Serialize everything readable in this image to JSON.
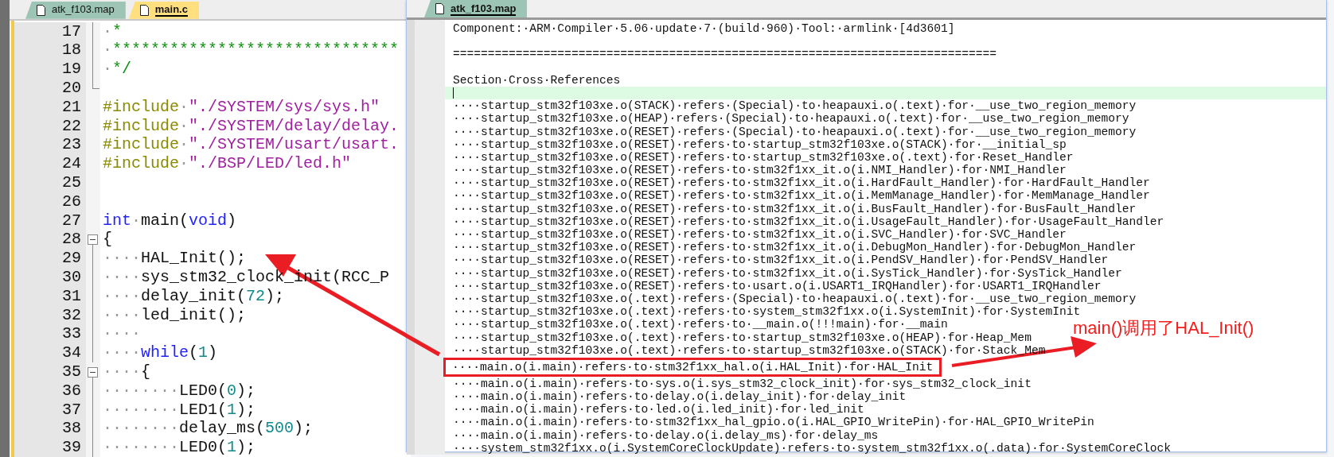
{
  "left_editor": {
    "tabs": [
      {
        "label": "atk_f103.map",
        "selected": false
      },
      {
        "label": "main.c",
        "selected": true
      }
    ],
    "lines": [
      {
        "number": "17",
        "kind": "fold_line",
        "tokens": [
          {
            "kind": "ws",
            "text": "·"
          },
          {
            "kind": "comment",
            "text": "*"
          }
        ]
      },
      {
        "number": "18",
        "kind": "fold_line",
        "tokens": [
          {
            "kind": "ws",
            "text": "·"
          },
          {
            "kind": "comment",
            "text": "******************************"
          }
        ]
      },
      {
        "number": "19",
        "kind": "fold_line",
        "tokens": [
          {
            "kind": "ws",
            "text": "·"
          },
          {
            "kind": "comment",
            "text": "*/"
          }
        ]
      },
      {
        "number": "20",
        "kind": "fold_end"
      },
      {
        "number": "21",
        "kind": "code",
        "tokens": [
          {
            "kind": "preproc",
            "text": "#include"
          },
          {
            "kind": "ws",
            "text": "·"
          },
          {
            "kind": "string",
            "text": "\"./SYSTEM/sys/sys.h\""
          }
        ]
      },
      {
        "number": "22",
        "kind": "code",
        "tokens": [
          {
            "kind": "preproc",
            "text": "#include"
          },
          {
            "kind": "ws",
            "text": "·"
          },
          {
            "kind": "string",
            "text": "\"./SYSTEM/delay/delay."
          }
        ]
      },
      {
        "number": "23",
        "kind": "code",
        "tokens": [
          {
            "kind": "preproc",
            "text": "#include"
          },
          {
            "kind": "ws",
            "text": "·"
          },
          {
            "kind": "string",
            "text": "\"./SYSTEM/usart/usart."
          }
        ]
      },
      {
        "number": "24",
        "kind": "code",
        "tokens": [
          {
            "kind": "preproc",
            "text": "#include"
          },
          {
            "kind": "ws",
            "text": "·"
          },
          {
            "kind": "string",
            "text": "\"./BSP/LED/led.h\""
          }
        ]
      },
      {
        "number": "25",
        "kind": "code"
      },
      {
        "number": "26",
        "kind": "code"
      },
      {
        "number": "27",
        "kind": "code",
        "tokens": [
          {
            "kind": "keyword",
            "text": "int"
          },
          {
            "kind": "ws",
            "text": "·"
          },
          {
            "kind": "plain",
            "text": "main("
          },
          {
            "kind": "keyword",
            "text": "void"
          },
          {
            "kind": "plain",
            "text": ")"
          }
        ]
      },
      {
        "number": "28",
        "kind": "fold_start",
        "tokens": [
          {
            "kind": "plain",
            "text": "{"
          }
        ]
      },
      {
        "number": "29",
        "kind": "fold_line",
        "tokens": [
          {
            "kind": "ws",
            "text": "····"
          },
          {
            "kind": "plain",
            "text": "HAL_Init();"
          }
        ]
      },
      {
        "number": "30",
        "kind": "fold_line",
        "tokens": [
          {
            "kind": "ws",
            "text": "····"
          },
          {
            "kind": "plain",
            "text": "sys_stm32_clock_init(RCC_P"
          }
        ]
      },
      {
        "number": "31",
        "kind": "fold_line",
        "tokens": [
          {
            "kind": "ws",
            "text": "····"
          },
          {
            "kind": "plain",
            "text": "delay_init("
          },
          {
            "kind": "number",
            "text": "72"
          },
          {
            "kind": "plain",
            "text": ");"
          }
        ]
      },
      {
        "number": "32",
        "kind": "fold_line",
        "tokens": [
          {
            "kind": "ws",
            "text": "····"
          },
          {
            "kind": "plain",
            "text": "led_init();"
          }
        ]
      },
      {
        "number": "33",
        "kind": "fold_line",
        "tokens": [
          {
            "kind": "ws",
            "text": "····"
          }
        ]
      },
      {
        "number": "34",
        "kind": "fold_line",
        "tokens": [
          {
            "kind": "ws",
            "text": "····"
          },
          {
            "kind": "keyword",
            "text": "while"
          },
          {
            "kind": "plain",
            "text": "("
          },
          {
            "kind": "number",
            "text": "1"
          },
          {
            "kind": "plain",
            "text": ")"
          }
        ]
      },
      {
        "number": "35",
        "kind": "fold_start",
        "tokens": [
          {
            "kind": "ws",
            "text": "····"
          },
          {
            "kind": "plain",
            "text": "{"
          }
        ]
      },
      {
        "number": "36",
        "kind": "fold_line",
        "tokens": [
          {
            "kind": "ws",
            "text": "········"
          },
          {
            "kind": "plain",
            "text": "LED0("
          },
          {
            "kind": "number",
            "text": "0"
          },
          {
            "kind": "plain",
            "text": ");"
          }
        ]
      },
      {
        "number": "37",
        "kind": "fold_line",
        "tokens": [
          {
            "kind": "ws",
            "text": "········"
          },
          {
            "kind": "plain",
            "text": "LED1("
          },
          {
            "kind": "number",
            "text": "1"
          },
          {
            "kind": "plain",
            "text": ");"
          }
        ]
      },
      {
        "number": "38",
        "kind": "fold_line",
        "tokens": [
          {
            "kind": "ws",
            "text": "········"
          },
          {
            "kind": "plain",
            "text": "delay_ms("
          },
          {
            "kind": "number",
            "text": "500"
          },
          {
            "kind": "plain",
            "text": ");"
          }
        ]
      },
      {
        "number": "39",
        "kind": "fold_line",
        "tokens": [
          {
            "kind": "ws",
            "text": "········"
          },
          {
            "kind": "plain",
            "text": "LED0("
          },
          {
            "kind": "number",
            "text": "1"
          },
          {
            "kind": "plain",
            "text": ");"
          }
        ]
      }
    ]
  },
  "map_window": {
    "tabs": [
      {
        "label": "atk_f103.map",
        "selected": true
      }
    ],
    "lines": [
      {
        "kind": "text",
        "text": "Component:·ARM·Compiler·5.06·update·7·(build·960)·Tool:·armlink·[4d3601]"
      },
      {
        "kind": "blank"
      },
      {
        "kind": "text",
        "text": "=============================================================================="
      },
      {
        "kind": "blank"
      },
      {
        "kind": "text",
        "text": "Section·Cross·References"
      },
      {
        "kind": "cursor"
      },
      {
        "kind": "text",
        "text": "····startup_stm32f103xe.o(STACK)·refers·(Special)·to·heapauxi.o(.text)·for·__use_two_region_memory"
      },
      {
        "kind": "text",
        "text": "····startup_stm32f103xe.o(HEAP)·refers·(Special)·to·heapauxi.o(.text)·for·__use_two_region_memory"
      },
      {
        "kind": "text",
        "text": "····startup_stm32f103xe.o(RESET)·refers·(Special)·to·heapauxi.o(.text)·for·__use_two_region_memory"
      },
      {
        "kind": "text",
        "text": "····startup_stm32f103xe.o(RESET)·refers·to·startup_stm32f103xe.o(STACK)·for·__initial_sp"
      },
      {
        "kind": "text",
        "text": "····startup_stm32f103xe.o(RESET)·refers·to·startup_stm32f103xe.o(.text)·for·Reset_Handler"
      },
      {
        "kind": "text",
        "text": "····startup_stm32f103xe.o(RESET)·refers·to·stm32f1xx_it.o(i.NMI_Handler)·for·NMI_Handler"
      },
      {
        "kind": "text",
        "text": "····startup_stm32f103xe.o(RESET)·refers·to·stm32f1xx_it.o(i.HardFault_Handler)·for·HardFault_Handler"
      },
      {
        "kind": "text",
        "text": "····startup_stm32f103xe.o(RESET)·refers·to·stm32f1xx_it.o(i.MemManage_Handler)·for·MemManage_Handler"
      },
      {
        "kind": "text",
        "text": "····startup_stm32f103xe.o(RESET)·refers·to·stm32f1xx_it.o(i.BusFault_Handler)·for·BusFault_Handler"
      },
      {
        "kind": "text",
        "text": "····startup_stm32f103xe.o(RESET)·refers·to·stm32f1xx_it.o(i.UsageFault_Handler)·for·UsageFault_Handler"
      },
      {
        "kind": "text",
        "text": "····startup_stm32f103xe.o(RESET)·refers·to·stm32f1xx_it.o(i.SVC_Handler)·for·SVC_Handler"
      },
      {
        "kind": "text",
        "text": "····startup_stm32f103xe.o(RESET)·refers·to·stm32f1xx_it.o(i.DebugMon_Handler)·for·DebugMon_Handler"
      },
      {
        "kind": "text",
        "text": "····startup_stm32f103xe.o(RESET)·refers·to·stm32f1xx_it.o(i.PendSV_Handler)·for·PendSV_Handler"
      },
      {
        "kind": "text",
        "text": "····startup_stm32f103xe.o(RESET)·refers·to·stm32f1xx_it.o(i.SysTick_Handler)·for·SysTick_Handler"
      },
      {
        "kind": "text",
        "text": "····startup_stm32f103xe.o(RESET)·refers·to·usart.o(i.USART1_IRQHandler)·for·USART1_IRQHandler"
      },
      {
        "kind": "text",
        "text": "····startup_stm32f103xe.o(.text)·refers·(Special)·to·heapauxi.o(.text)·for·__use_two_region_memory"
      },
      {
        "kind": "text",
        "text": "····startup_stm32f103xe.o(.text)·refers·to·system_stm32f1xx.o(i.SystemInit)·for·SystemInit"
      },
      {
        "kind": "text",
        "text": "····startup_stm32f103xe.o(.text)·refers·to·__main.o(!!!main)·for·__main"
      },
      {
        "kind": "text",
        "text": "····startup_stm32f103xe.o(.text)·refers·to·startup_stm32f103xe.o(HEAP)·for·Heap_Mem"
      },
      {
        "kind": "text",
        "text": "····startup_stm32f103xe.o(.text)·refers·to·startup_stm32f103xe.o(STACK)·for·Stack_Mem"
      },
      {
        "kind": "boxed",
        "text": "····main.o(i.main)·refers·to·stm32f1xx_hal.o(i.HAL_Init)·for·HAL_Init"
      },
      {
        "kind": "text",
        "text": "····main.o(i.main)·refers·to·sys.o(i.sys_stm32_clock_init)·for·sys_stm32_clock_init"
      },
      {
        "kind": "text",
        "text": "····main.o(i.main)·refers·to·delay.o(i.delay_init)·for·delay_init"
      },
      {
        "kind": "text",
        "text": "····main.o(i.main)·refers·to·led.o(i.led_init)·for·led_init"
      },
      {
        "kind": "text",
        "text": "····main.o(i.main)·refers·to·stm32f1xx_hal_gpio.o(i.HAL_GPIO_WritePin)·for·HAL_GPIO_WritePin"
      },
      {
        "kind": "text",
        "text": "····main.o(i.main)·refers·to·delay.o(i.delay_ms)·for·delay_ms"
      },
      {
        "kind": "text",
        "text": "····system_stm32f1xx.o(i.SystemCoreClockUpdate)·refers·to·system_stm32f1xx.o(.data)·for·SystemCoreClock"
      }
    ]
  },
  "annotation": {
    "text": "main()调用了HAL_Init()"
  }
}
